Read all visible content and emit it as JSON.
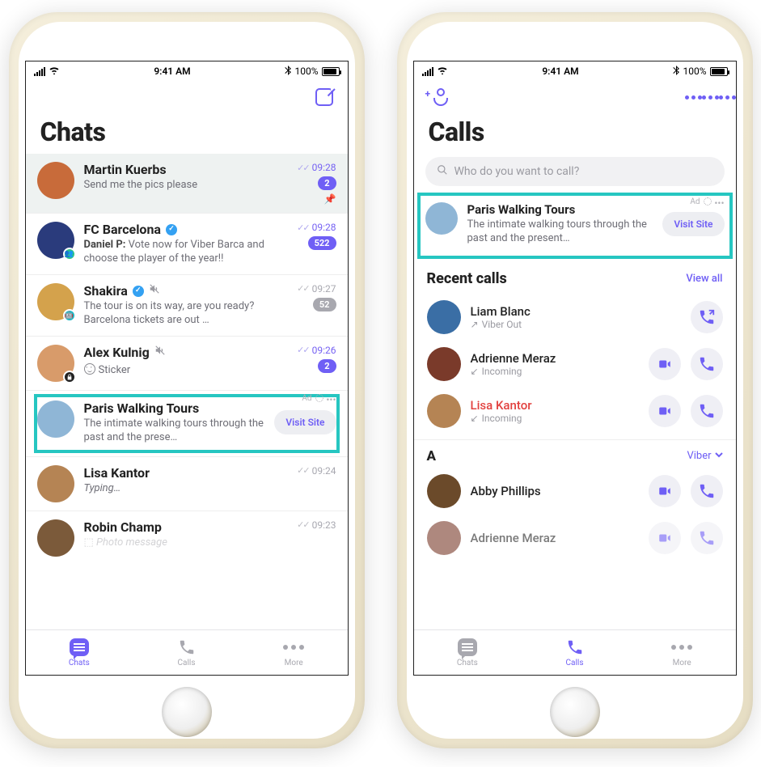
{
  "status": {
    "time": "9:41 AM",
    "battery_pct": "100%"
  },
  "left": {
    "title": "Chats",
    "tabs": {
      "chats": "Chats",
      "calls": "Calls",
      "more": "More"
    },
    "rows": [
      {
        "name": "Martin Kuerbs",
        "preview": "Send me the pics please",
        "time": "09:28",
        "badge": "2",
        "avatar_bg": "#c86b3a"
      },
      {
        "name": "FC Barcelona",
        "preview_prefix": "Daniel P:",
        "preview": " Vote now for Viber Barca and choose the player of the year!!",
        "time": "09:28",
        "badge": "522",
        "avatar_bg": "#2a3b7c"
      },
      {
        "name": "Shakira",
        "preview": "The tour is on its way, are you ready? Barcelona tickets are out …",
        "time": "09:27",
        "badge": "52",
        "avatar_bg": "#d4a24c"
      },
      {
        "name": "Alex Kulnig",
        "preview": "Sticker",
        "time": "09:26",
        "badge": "2",
        "avatar_bg": "#d89b6a"
      },
      {
        "name": "Lisa Kantor",
        "preview": "Typing…",
        "time": "09:24",
        "avatar_bg": "#b58454"
      },
      {
        "name": "Robin Champ",
        "preview": "Photo message",
        "time": "09:23",
        "avatar_bg": "#7b5a3a"
      }
    ],
    "ad": {
      "label": "Ad",
      "title": "Paris Walking Tours",
      "desc": "The intimate walking tours through the past and the prese…",
      "cta": "Visit Site",
      "avatar_bg": "#8fb6d6"
    }
  },
  "right": {
    "title": "Calls",
    "search_placeholder": "Who do you want to call?",
    "ad": {
      "label": "Ad",
      "title": "Paris Walking Tours",
      "desc": "The intimate walking tours through the past and the present…",
      "cta": "Visit Site",
      "avatar_bg": "#8fb6d6"
    },
    "recent": {
      "title": "Recent calls",
      "view_all": "View all",
      "items": [
        {
          "name": "Liam Blanc",
          "sub": "Viber Out",
          "dir": "out",
          "avatar_bg": "#3a6ea5"
        },
        {
          "name": "Adrienne Meraz",
          "sub": "Incoming",
          "dir": "in",
          "missed": false,
          "avatar_bg": "#7a3a2a"
        },
        {
          "name": "Lisa Kantor",
          "sub": "Incoming",
          "dir": "in",
          "missed": true,
          "avatar_bg": "#b58454"
        }
      ]
    },
    "alpha": {
      "letter": "A",
      "filter": "Viber",
      "contacts": [
        {
          "name": "Abby Phillips",
          "avatar_bg": "#6b4a2a"
        },
        {
          "name": "Adrienne Meraz",
          "avatar_bg": "#7a3a2a"
        }
      ]
    },
    "tabs": {
      "chats": "Chats",
      "calls": "Calls",
      "more": "More"
    }
  }
}
